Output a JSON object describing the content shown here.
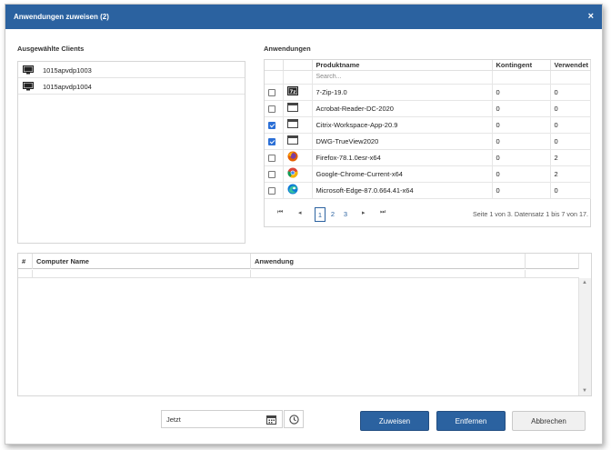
{
  "dialog": {
    "title": "Anwendungen zuweisen (2)",
    "close_label": "×"
  },
  "clients": {
    "label": "Ausgewählte Clients",
    "items": [
      {
        "name": "1015apvdp1003"
      },
      {
        "name": "1015apvdp1004"
      }
    ]
  },
  "apps": {
    "label": "Anwendungen",
    "columns": {
      "product": "Produktname",
      "quota": "Kontingent",
      "used": "Verwendet"
    },
    "search_placeholder": "Search...",
    "rows": [
      {
        "name": "7-Zip-19.0",
        "quota": "0",
        "used": "0",
        "checked": false,
        "icon": "7zip-icon"
      },
      {
        "name": "Acrobat-Reader-DC-2020",
        "quota": "0",
        "used": "0",
        "checked": false,
        "icon": "app-window-icon"
      },
      {
        "name": "Citrix-Workspace-App-20.9",
        "quota": "0",
        "used": "0",
        "checked": true,
        "icon": "app-window-icon"
      },
      {
        "name": "DWG-TrueView2020",
        "quota": "0",
        "used": "0",
        "checked": true,
        "icon": "app-window-icon"
      },
      {
        "name": "Firefox-78.1.0esr-x64",
        "quota": "0",
        "used": "2",
        "checked": false,
        "icon": "firefox-icon"
      },
      {
        "name": "Google-Chrome-Current-x64",
        "quota": "0",
        "used": "2",
        "checked": false,
        "icon": "chrome-icon"
      },
      {
        "name": "Microsoft-Edge-87.0.664.41-x64",
        "quota": "0",
        "used": "0",
        "checked": false,
        "icon": "edge-icon"
      }
    ],
    "pager": {
      "first": "⏮",
      "prev": "◂",
      "next": "▸",
      "last": "⏭",
      "pages": [
        "1",
        "2",
        "3"
      ],
      "active_page": "1",
      "info": "Seite 1 von 3. Datensatz 1 bis 7 von 17."
    }
  },
  "results": {
    "columns": {
      "index": "#",
      "computer": "Computer Name",
      "application": "Anwendung"
    }
  },
  "footer": {
    "date_value": "Jetzt",
    "assign_label": "Zuweisen",
    "remove_label": "Entfernen",
    "cancel_label": "Abbrechen"
  },
  "colors": {
    "accent": "#2b62a0",
    "checkbox": "#2b6fd6"
  }
}
